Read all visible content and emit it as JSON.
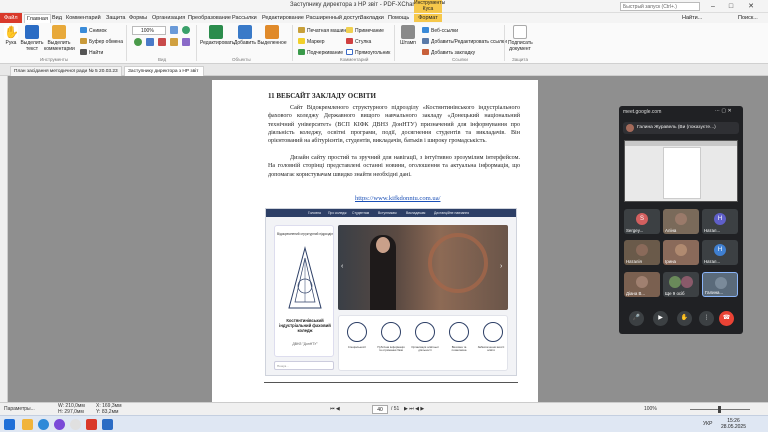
{
  "titlebar": {
    "title": "Заступнику директора з НР звіт - PDF-XChange Editor",
    "context_tab": "Инструменты Куса",
    "search_placeholder": "Быстрый запуск (Ctrl+.)",
    "find_label": "Найти...",
    "search2_label": "Поиск..."
  },
  "menu": {
    "file": "Файл",
    "items": [
      "Главная",
      "Вид",
      "Комментарий",
      "Защита",
      "Формы",
      "Организация",
      "Преобразование",
      "Рассылки",
      "Редактирование",
      "Расширенный доступ",
      "Закладки",
      "Помощь"
    ],
    "format": "Формат"
  },
  "ribbon": {
    "hand": "Рука",
    "select_text": "Выделить текст",
    "select_comments": "Выделить комментарии",
    "snapshot": "Снимок",
    "clipboard": "Буфер обмена",
    "find": "Найти",
    "zoom": "100%",
    "edit": "Редактировать",
    "add": "Добавить",
    "select": "Выделенное",
    "typewriter": "Печатная машинка",
    "marker": "Маркер",
    "underline": "Подчеркивание",
    "note": "Примечание",
    "strikeout": "Стулка",
    "rectangle": "Прямоугольник",
    "stamp": "Штамп",
    "web_links": "Веб-ссылки",
    "add_edit_links": "Добавить/Редактировать ссылки",
    "add_bookmark": "Добавить закладку",
    "sign": "Подписать документ",
    "groups": {
      "tools": "Инструменты",
      "view": "Вид",
      "objects": "Объекты",
      "comments": "Комментарий",
      "links": "Ссылки",
      "protect": "Защита"
    }
  },
  "tabs": [
    {
      "label": "План засідання методичної ради № 5 20.03.23"
    },
    {
      "label": "Заступнику директора з НР звіт"
    }
  ],
  "document": {
    "heading": "11 ВЕБСАЙТ ЗАКЛАДУ ОСВІТИ",
    "para1": "Сайт Відокремленого структурного підрозділу «Костянтинівського індустріального фахового коледжу Державного вищого навчального закладу «Донецький національний технічний університет» (ВСП КІФК ДВНЗ ДонНТУ) призначений для інформування про діяльність коледжу, освітні програми, події, досягнення студентів та викладачів. Він орієнтований на абітурієнтів, студентів, викладачів, батьків і широку громадськість.",
    "para2": "Дизайн сайту простий та зручний для навігації, з інтуїтивно зрозумілим інтерфейсом. На головній сторінці представлені останні новини, оголошення та актуальна інформація, що допомагає користувачам швидко знайти необхідні дані.",
    "link": "https://www.kifkdonntu.com.ua/"
  },
  "site": {
    "nav": [
      "Головна",
      "Про коледж",
      "Студентам",
      "Вступникам",
      "Викладачам",
      "Дистанційне навчання"
    ],
    "card_top": "Відокремлений структурний підрозділ",
    "card_name": "Костянтинівський індустріальний фаховий коледж",
    "card_sub": "ДВНЗ \"ДонНТУ\"",
    "search_placeholder": "Пошук...",
    "icons": [
      {
        "label": "Спеціальності",
        "icon": "tools-icon"
      },
      {
        "label": "Публічна інформація та отримання бази",
        "icon": "info-icon"
      },
      {
        "label": "Організація освітньої діяльності",
        "icon": "gear-icon"
      },
      {
        "label": "Виховна та позакласна",
        "icon": "heart-icon"
      },
      {
        "label": "Забезпечення якості освіти",
        "icon": "graduation-cap-icon"
      }
    ]
  },
  "meet": {
    "url": "meet.google.com",
    "presenter": "Галина Журавель (Ви (показуєте...)",
    "tiles": [
      {
        "name": "Sergey...",
        "avatar": "S",
        "color": "#d35f5f"
      },
      {
        "name": "Аліна",
        "avatar": "",
        "color": "#7a6a5a"
      },
      {
        "name": "Натал...",
        "avatar": "Н",
        "color": "#5f5fc9"
      },
      {
        "name": "Наталія",
        "avatar": "",
        "color": "#6a5a4a"
      },
      {
        "name": "Ірина",
        "avatar": "",
        "color": "#8a6a5a"
      },
      {
        "name": "Натал...",
        "avatar": "Н",
        "color": "#3f7fd0"
      },
      {
        "name": "Діана В...",
        "avatar": "",
        "color": "#7a6050"
      },
      {
        "name": "Ще 9 осіб",
        "avatar": "",
        "color": "#555"
      },
      {
        "name": "Галина...",
        "avatar": "",
        "color": "#5a6a7a"
      }
    ]
  },
  "status": {
    "options": "Параметры...",
    "width": "W: 210,0мм",
    "height": "H: 297,0мм",
    "x": "X: 169,3мм",
    "y": "Y: 83,2мм",
    "page": "40",
    "page_total": "/ 51",
    "zoom": "100%"
  },
  "taskbar": {
    "lang": "УКР",
    "time": "15:26",
    "date": "28.05.2025"
  }
}
